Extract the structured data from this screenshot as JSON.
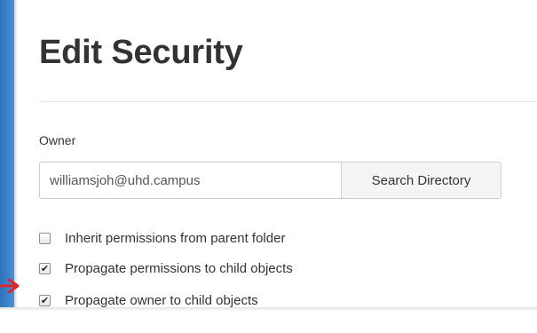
{
  "dialog": {
    "title": "Edit Security"
  },
  "owner": {
    "label": "Owner",
    "value": "williamsjoh@uhd.campus",
    "search_button_label": "Search Directory"
  },
  "options": [
    {
      "label": "Inherit permissions from parent folder",
      "checked": false
    },
    {
      "label": "Propagate permissions to child objects",
      "checked": true
    },
    {
      "label": "Propagate owner to child objects",
      "checked": true
    }
  ],
  "colors": {
    "accent": "#3a80c9",
    "annotation_arrow": "#e0242c",
    "text": "#333333",
    "border": "#cccccc"
  },
  "icons": {
    "check": "✔",
    "annotation": "arrow-right-icon"
  }
}
